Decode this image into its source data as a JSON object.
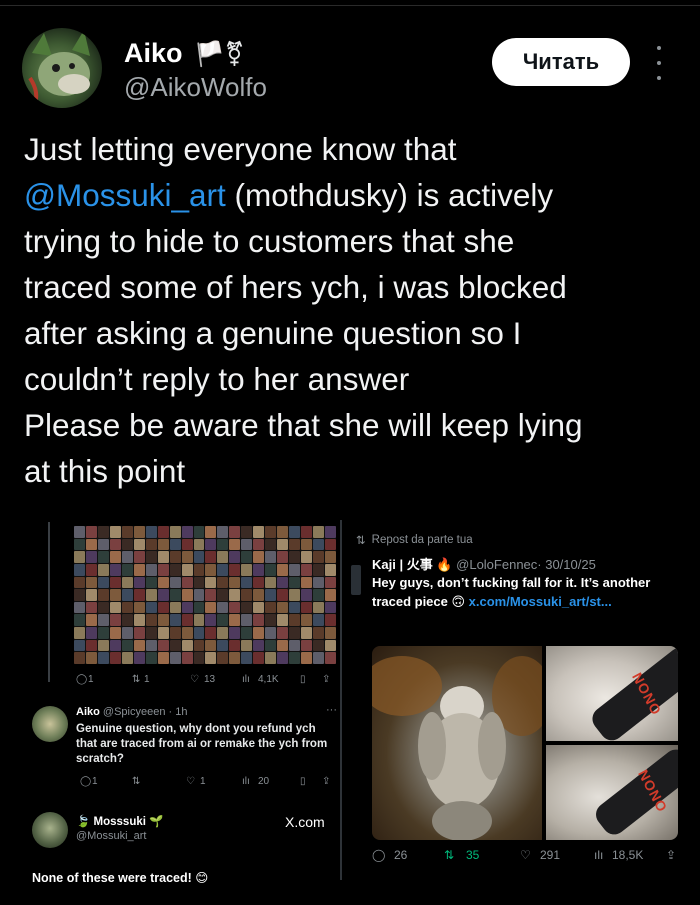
{
  "author": {
    "display_name": "Aiko",
    "name_emojis": "🏳️⚧",
    "handle": "@AikoWolfo"
  },
  "actions": {
    "read_button": "Читать"
  },
  "tweet": {
    "line1": "Just letting everyone know that",
    "mention": "@Mossuki_art",
    "line2_rest": " (mothdusky) is actively",
    "line3": "trying to hide to customers that she",
    "line4": "traced some of hers ych, i was blocked",
    "line5": "after asking a genuine question so I",
    "line6": "couldn’t reply to her answer",
    "line7": "Please be aware that she will keep lying",
    "line8": "at this point"
  },
  "screenshot": {
    "left": {
      "top_stats": {
        "replies": "1",
        "reposts": "1",
        "likes": "13",
        "views": "4,1K"
      },
      "reply": {
        "name": "Aiko",
        "handle": "@Spicyeeen",
        "time": "· 1h",
        "text": "Genuine question, why dont you refund ych that are traced from ai or remake the ych from scratch?",
        "stats": {
          "replies": "1",
          "likes": "1",
          "views": "20"
        }
      },
      "mossuki": {
        "name": "Mosssuki",
        "handle": "@Mossuki_art",
        "link_label": "X.com",
        "text": "None of these were traced! 😊"
      }
    },
    "right": {
      "repost_label": "Repost da parte tua",
      "author": "Kaji | 火事 🔥",
      "handle": "@LoloFennec",
      "date": "· 30/10/25",
      "text": "Hey guys, don’t fucking fall for it. It’s another traced piece 🙃",
      "link": "x.com/Mossuki_art/st...",
      "watermark": "NONO",
      "stats": {
        "replies": "26",
        "reposts": "35",
        "likes": "291",
        "views": "18,5K"
      }
    }
  }
}
